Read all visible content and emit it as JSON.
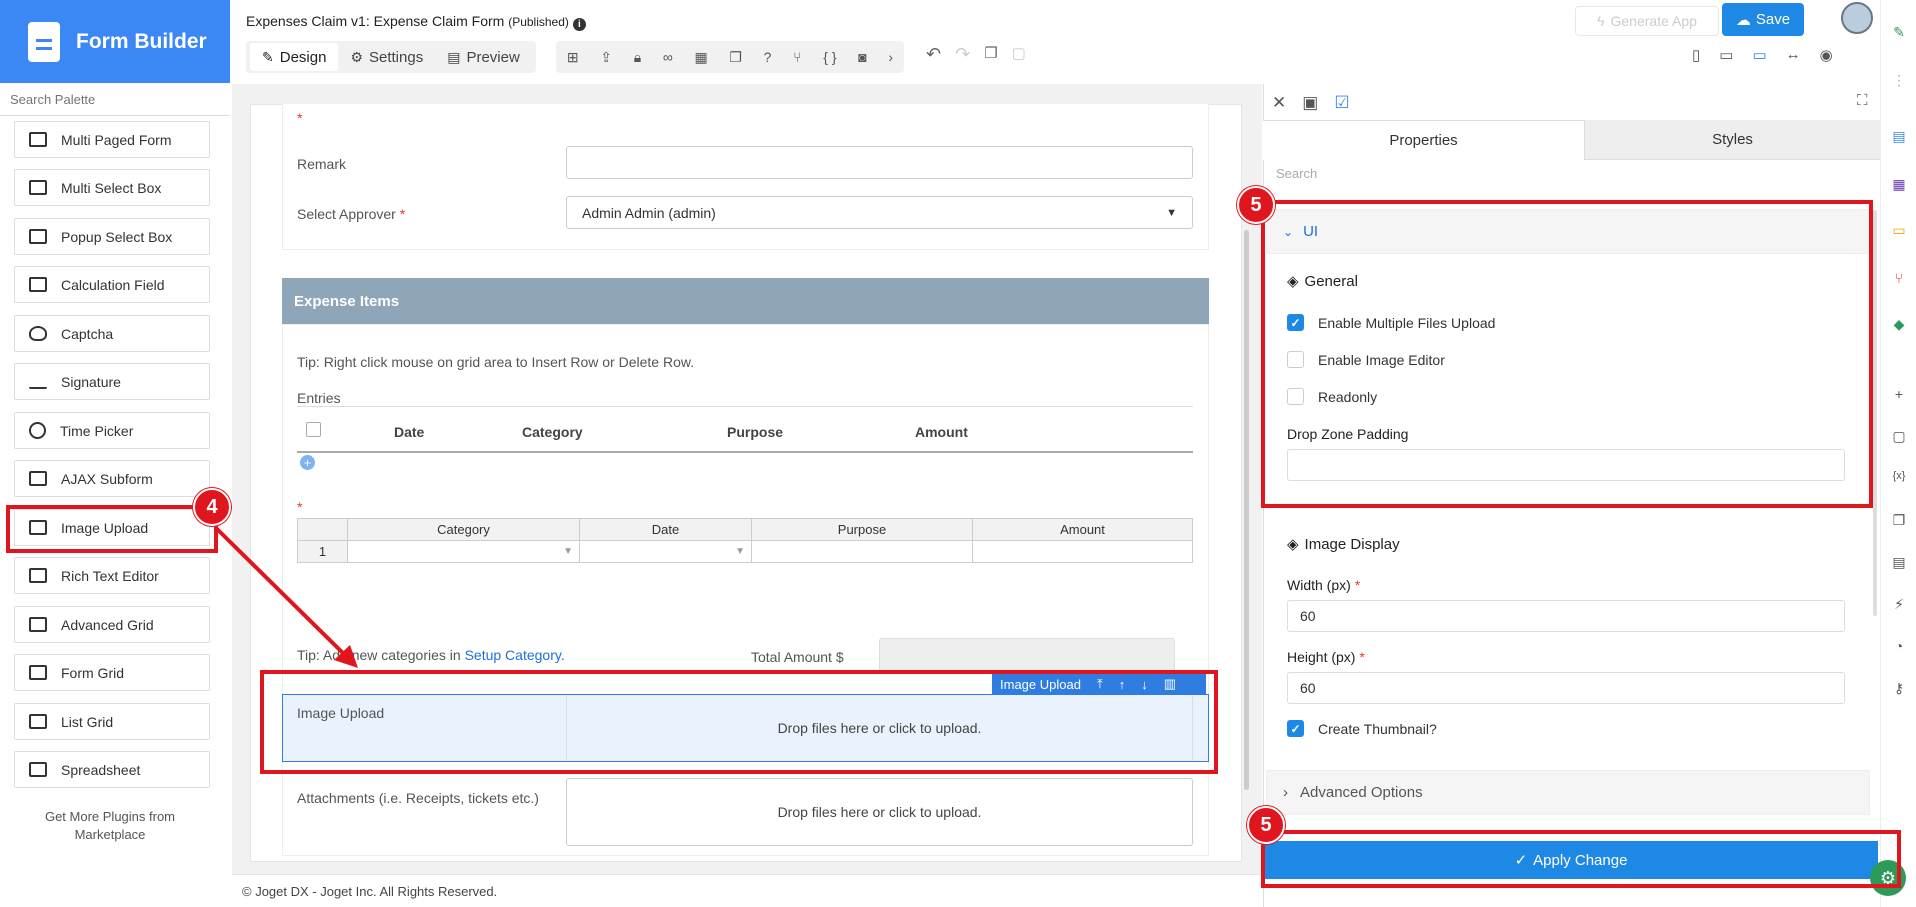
{
  "app": {
    "brand": "Form Builder"
  },
  "header": {
    "title": "Expenses Claim v1: Expense Claim Form",
    "status": "(Published)",
    "tabs": [
      {
        "label": "Design"
      },
      {
        "label": "Settings"
      },
      {
        "label": "Preview"
      }
    ],
    "generate_app": "Generate App",
    "save": "Save"
  },
  "palette": {
    "search_placeholder": "Search Palette",
    "items": [
      {
        "label": "Multi Paged Form"
      },
      {
        "label": "Multi Select Box"
      },
      {
        "label": "Popup Select Box"
      },
      {
        "label": "Calculation Field"
      },
      {
        "label": "Captcha"
      },
      {
        "label": "Signature"
      },
      {
        "label": "Time Picker"
      },
      {
        "label": "AJAX Subform"
      },
      {
        "label": "Image Upload"
      },
      {
        "label": "Rich Text Editor"
      },
      {
        "label": "Advanced Grid"
      },
      {
        "label": "Form Grid"
      },
      {
        "label": "List Grid"
      },
      {
        "label": "Spreadsheet"
      }
    ],
    "more": "Get More Plugins from Marketplace"
  },
  "form": {
    "remark_label": "Remark",
    "approver_label": "Select Approver",
    "approver_value": "Admin Admin (admin)",
    "section_title": "Expense Items",
    "tip_grid": "Tip: Right click mouse on grid area to Insert Row or Delete Row.",
    "entries_label": "Entries",
    "entries_columns": [
      "Date",
      "Category",
      "Purpose",
      "Amount"
    ],
    "grid_columns": [
      "Category",
      "Date",
      "Purpose",
      "Amount"
    ],
    "grid_row_no": "1",
    "tip_categories_prefix": "Tip: Add new categories in",
    "tip_categories_link": "Setup Category",
    "tip_categories_suffix": ".",
    "total_label": "Total Amount $",
    "image_upload_label": "Image Upload",
    "image_upload_drop": "Drop files here or click to upload.",
    "image_upload_toolbar": "Image Upload",
    "attachments_label": "Attachments (i.e. Receipts, tickets etc.)",
    "attachments_drop": "Drop files here or click to upload."
  },
  "footer": "© Joget DX - Joget Inc. All Rights Reserved.",
  "properties": {
    "tabs": [
      {
        "label": "Properties"
      },
      {
        "label": "Styles"
      }
    ],
    "search_placeholder": "Search",
    "ui_section": "UI",
    "general": "General",
    "checks": [
      {
        "label": "Enable Multiple Files Upload",
        "checked": true
      },
      {
        "label": "Enable Image Editor",
        "checked": false
      },
      {
        "label": "Readonly",
        "checked": false
      }
    ],
    "drop_zone_padding": "Drop Zone Padding",
    "image_display": "Image Display",
    "width_label": "Width (px)",
    "width_value": "60",
    "height_label": "Height (px)",
    "height_value": "60",
    "thumbnail_label": "Create Thumbnail?",
    "thumbnail_checked": true,
    "advanced": "Advanced Options",
    "apply": "Apply Change"
  },
  "annotations": {
    "step4": "4",
    "step5a": "5",
    "step5b": "5"
  },
  "colors": {
    "brand": "#3a87f5",
    "primary": "#1e88e5",
    "annotation": "#e0161e",
    "section": "#8fa5b8"
  }
}
